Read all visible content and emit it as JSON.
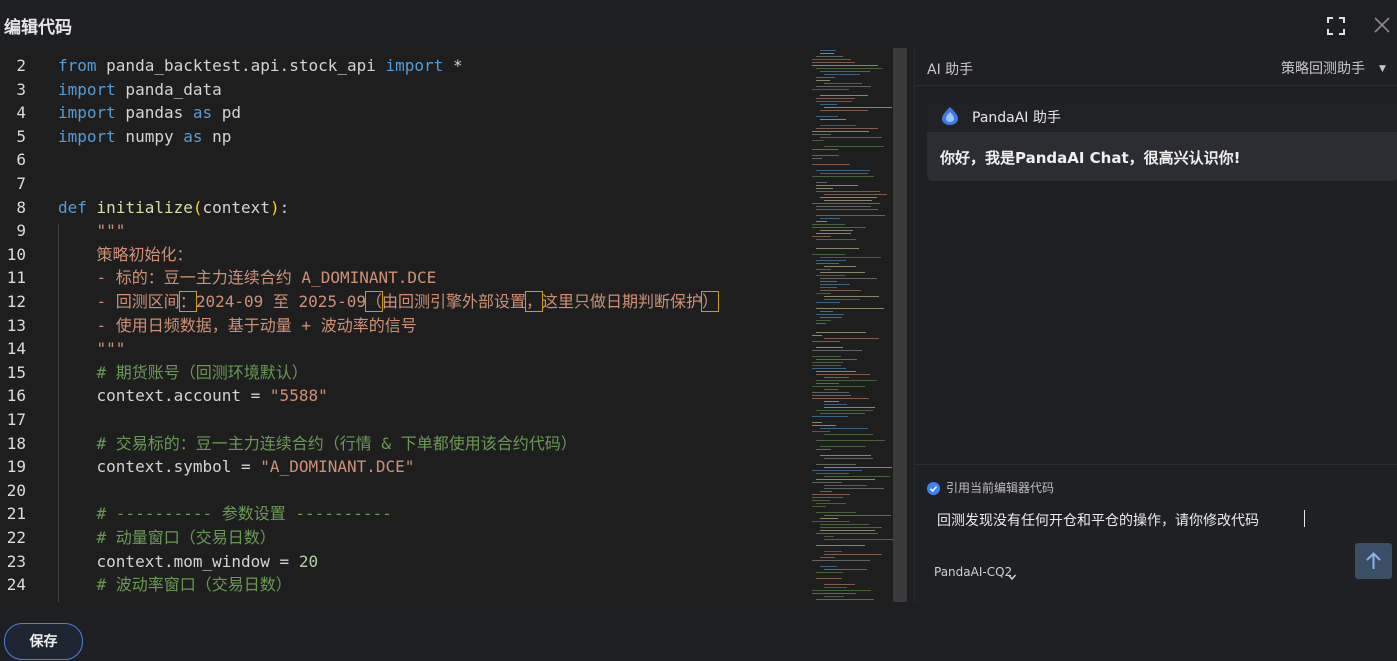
{
  "window": {
    "title": "编辑代码"
  },
  "editor": {
    "lines": [
      {
        "n": "2",
        "parts": [
          [
            "kw",
            "from"
          ],
          [
            "id",
            " panda_backtest.api.stock_api "
          ],
          [
            "kw",
            "import"
          ],
          [
            "id",
            " *"
          ]
        ]
      },
      {
        "n": "3",
        "parts": [
          [
            "kw",
            "import"
          ],
          [
            "id",
            " panda_data"
          ]
        ]
      },
      {
        "n": "4",
        "parts": [
          [
            "kw",
            "import"
          ],
          [
            "id",
            " pandas "
          ],
          [
            "kw",
            "as"
          ],
          [
            "id",
            " pd"
          ]
        ]
      },
      {
        "n": "5",
        "parts": [
          [
            "kw",
            "import"
          ],
          [
            "id",
            " numpy "
          ],
          [
            "kw",
            "as"
          ],
          [
            "id",
            " np"
          ]
        ]
      },
      {
        "n": "6",
        "parts": []
      },
      {
        "n": "7",
        "parts": []
      },
      {
        "n": "8",
        "parts": [
          [
            "kw",
            "def"
          ],
          [
            "id",
            " "
          ],
          [
            "fn",
            "initialize"
          ],
          [
            "brk",
            "("
          ],
          [
            "id",
            "context"
          ],
          [
            "brk",
            ")"
          ],
          [
            "id",
            ":"
          ]
        ]
      },
      {
        "n": "9",
        "parts": [
          [
            "str",
            "    \"\"\""
          ]
        ]
      },
      {
        "n": "10",
        "parts": [
          [
            "str",
            "    策略初始化："
          ]
        ]
      },
      {
        "n": "11",
        "parts": [
          [
            "str",
            "    - 标的：豆一主力连续合约 A_DOMINANT.DCE"
          ]
        ]
      },
      {
        "n": "12",
        "parts": [
          [
            "str",
            "    - 回测区间"
          ],
          [
            "strhl",
            "："
          ],
          [
            "str",
            "2024-09 至 2025-09"
          ],
          [
            "strhl",
            "（"
          ],
          [
            "str",
            "由回测引擎外部设置"
          ],
          [
            "strhl",
            "，"
          ],
          [
            "str",
            "这里只做日期判断保护"
          ],
          [
            "strhl",
            "）"
          ]
        ]
      },
      {
        "n": "13",
        "parts": [
          [
            "str",
            "    - 使用日频数据，基于动量 + 波动率的信号"
          ]
        ]
      },
      {
        "n": "14",
        "parts": [
          [
            "str",
            "    \"\"\""
          ]
        ]
      },
      {
        "n": "15",
        "parts": [
          [
            "cm",
            "    # 期货账号（回测环境默认）"
          ]
        ]
      },
      {
        "n": "16",
        "parts": [
          [
            "id",
            "    context.account = "
          ],
          [
            "str",
            "\"5588\""
          ]
        ]
      },
      {
        "n": "17",
        "parts": []
      },
      {
        "n": "18",
        "parts": [
          [
            "cm",
            "    # 交易标的：豆一主力连续合约（行情 & 下单都使用该合约代码）"
          ]
        ]
      },
      {
        "n": "19",
        "parts": [
          [
            "id",
            "    context.symbol = "
          ],
          [
            "str",
            "\"A_DOMINANT.DCE\""
          ]
        ]
      },
      {
        "n": "20",
        "parts": []
      },
      {
        "n": "21",
        "parts": [
          [
            "cm",
            "    # ---------- 参数设置 ----------"
          ]
        ]
      },
      {
        "n": "22",
        "parts": [
          [
            "cm",
            "    # 动量窗口（交易日数）"
          ]
        ]
      },
      {
        "n": "23",
        "parts": [
          [
            "id",
            "    context.mom_window = "
          ],
          [
            "num",
            "20"
          ]
        ]
      },
      {
        "n": "24",
        "parts": [
          [
            "cm",
            "    # 波动率窗口（交易日数）"
          ]
        ]
      }
    ]
  },
  "assistant": {
    "panel_label": "AI 助手",
    "mode": "策略回测助手",
    "bot_name": "PandaAI 助手",
    "greeting": "你好，我是PandaAI Chat，很高兴认识你!",
    "reference_label": "引用当前编辑器代码",
    "prompt_text": "回测发现没有任何开仓和平仓的操作，请你修改代码",
    "model": "PandaAI-CQ2"
  },
  "footer": {
    "save_label": "保存"
  },
  "colors": {
    "accent": "#4d7fd6",
    "check": "#3b82f6",
    "send_bg": "#3a4e66"
  },
  "icons": [
    "fullscreen-icon",
    "close-icon",
    "panda-logo-icon",
    "checkbox-checked-icon",
    "chevron-down-icon",
    "send-arrow-icon"
  ]
}
